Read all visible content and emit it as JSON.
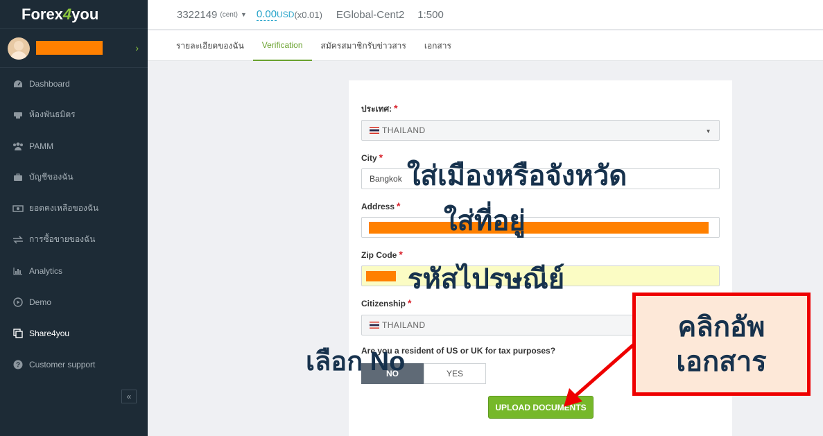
{
  "sidebar": {
    "logo_prefix": "Forex",
    "logo_four": "4",
    "logo_suffix": "you",
    "items": [
      {
        "label": "Dashboard",
        "icon": "dashboard-icon"
      },
      {
        "label": "ห้องพันธมิตร",
        "icon": "partner-icon"
      },
      {
        "label": "PAMM",
        "icon": "users-icon"
      },
      {
        "label": "บัญชีของฉัน",
        "icon": "briefcase-icon"
      },
      {
        "label": "ยอดคงเหลือของฉัน",
        "icon": "money-icon"
      },
      {
        "label": "การซื้อขายของฉัน",
        "icon": "exchange-icon"
      },
      {
        "label": "Analytics",
        "icon": "bar-chart-icon"
      },
      {
        "label": "Demo",
        "icon": "play-icon"
      },
      {
        "label": "Share4you",
        "icon": "copy-icon"
      },
      {
        "label": "Customer support",
        "icon": "help-icon"
      }
    ],
    "active_item": "Share4you",
    "collapse_label": "«",
    "profile_chevron": "›"
  },
  "topbar": {
    "account_number": "3322149",
    "account_type": "(cent)",
    "balance": "0.00",
    "currency": "USD",
    "rate": "(x0.01)",
    "server": "EGlobal-Cent2",
    "leverage": "1:500"
  },
  "tabs": [
    {
      "label": "รายละเอียดของฉัน",
      "active": false
    },
    {
      "label": "Verification",
      "active": true
    },
    {
      "label": "สมัครสมาชิกรับข่าวสาร",
      "active": false
    },
    {
      "label": "เอกสาร",
      "active": false
    }
  ],
  "form": {
    "country_label": "ประเทศ:",
    "country_value": "THAILAND",
    "city_label": "City",
    "city_value": "Bangkok",
    "address_label": "Address",
    "zip_label": "Zip Code",
    "citizenship_label": "Citizenship",
    "citizenship_value": "THAILAND",
    "resident_question": "Are you a resident of US or UK for tax purposes?",
    "no_label": "NO",
    "yes_label": "YES",
    "resident_selected": "NO",
    "upload_button": "UPLOAD DOCUMENTS"
  },
  "annotations": {
    "city_hint": "ใส่เมืองหรือจังหวัด",
    "address_hint": "ใส่ที่อยู่",
    "zip_hint": "รหัสไปรษณีย์",
    "no_hint": "เลือก No",
    "callout_line1": "คลิกอัพ",
    "callout_line2": "เอกสาร"
  },
  "colors": {
    "sidebar_bg": "#1d2b36",
    "accent_green": "#76b82a",
    "link_blue": "#25a3c9",
    "redaction_orange": "#ff8000",
    "callout_red": "#e00"
  }
}
